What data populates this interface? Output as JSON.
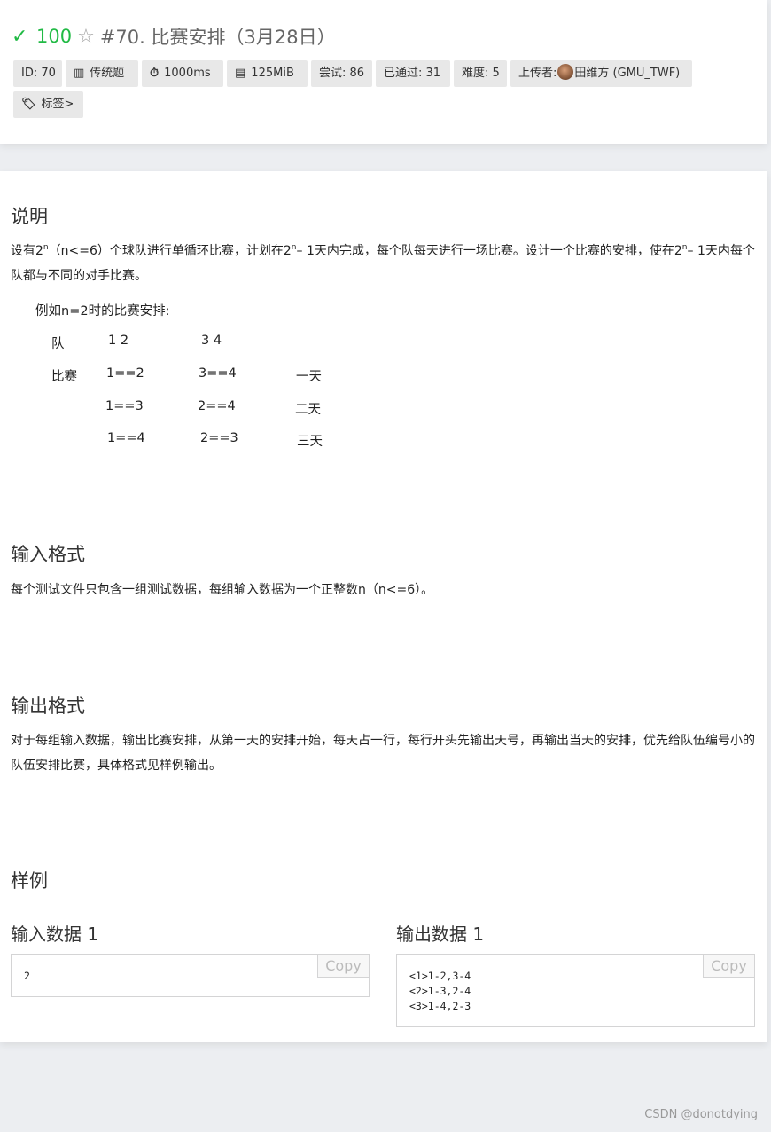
{
  "header": {
    "check_icon": "✓",
    "score": "100",
    "star_icon": "☆",
    "title": "#70. 比赛安排（3月28日）"
  },
  "labels": {
    "id": "ID: 70",
    "type": "传统题",
    "time": "1000ms",
    "memory": "125MiB",
    "attempts": "尝试: 86",
    "passed": "已通过: 31",
    "difficulty": "难度: 5",
    "uploader_prefix": "上传者:",
    "uploader_name": "田维方 (GMU_TWF)",
    "tags": "标签>"
  },
  "description": {
    "heading": "说明",
    "p1_a": "设有2",
    "p1_sup1": "n",
    "p1_b": "（n<=6）个球队进行单循环比赛，计划在2",
    "p1_sup2": "n",
    "p1_c": "– 1天内完成，每个队每天进行一场比赛。设计一个比赛的安排，使在2",
    "p1_sup3": "n",
    "p1_d": "– 1天内每个队都与不同的对手比赛。",
    "example_intro": "例如n=2时的比赛安排:",
    "table": {
      "row0": [
        "队",
        "1  2",
        "3  4",
        ""
      ],
      "row1": [
        "比赛",
        "1==2",
        "3==4",
        "一天"
      ],
      "row2": [
        "",
        "1==3",
        "2==4",
        "二天"
      ],
      "row3": [
        "",
        "1==4",
        "2==3",
        "三天"
      ]
    }
  },
  "input_format": {
    "heading": "输入格式",
    "text": "每个测试文件只包含一组测试数据，每组输入数据为一个正整数n（n<=6）。"
  },
  "output_format": {
    "heading": "输出格式",
    "text": "对于每组输入数据，输出比赛安排，从第一天的安排开始，每天占一行，每行开头先输出天号，再输出当天的安排，优先给队伍编号小的队伍安排比赛，具体格式见样例输出。"
  },
  "samples": {
    "heading": "样例",
    "input_title": "输入数据 1",
    "input_code": "2",
    "output_title": "输出数据 1",
    "output_code": "<1>1-2,3-4\n<2>1-3,2-4\n<3>1-4,2-3",
    "copy_label": "Copy"
  },
  "watermark": "CSDN @donotdying"
}
